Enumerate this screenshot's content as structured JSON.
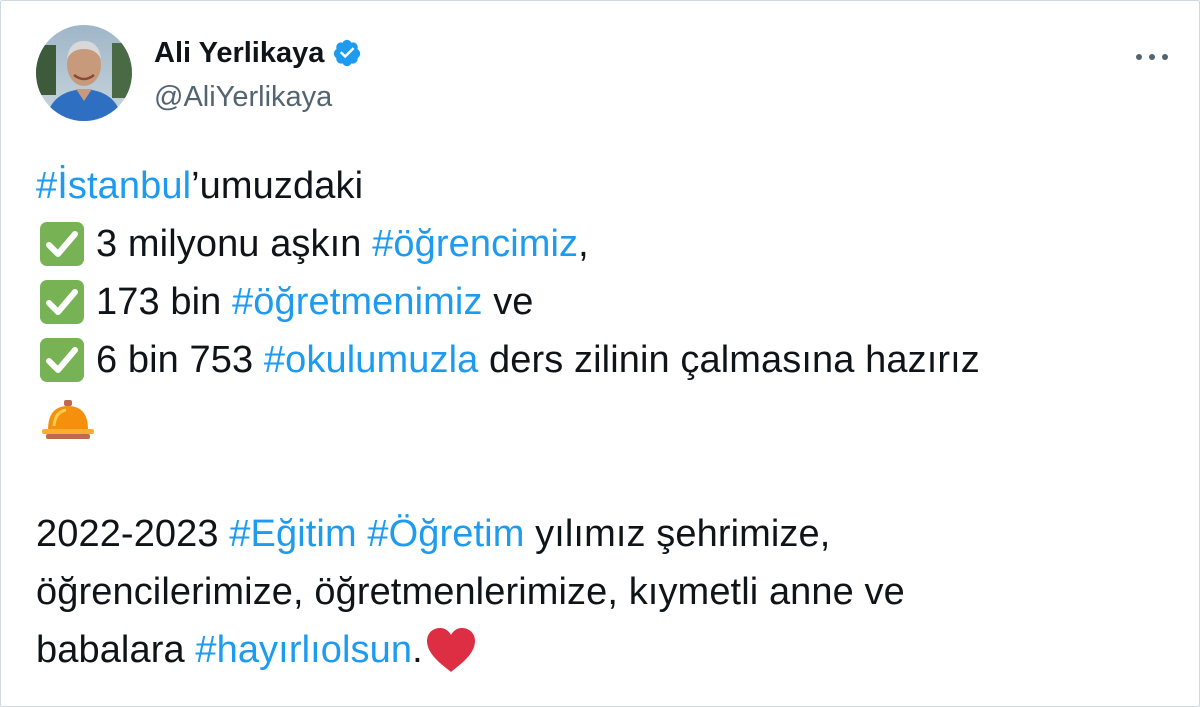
{
  "author": {
    "display_name": "Ali Yerlikaya",
    "handle": "@AliYerlikaya",
    "verified_icon": "verified-badge-icon",
    "avatar_icon": "profile-photo"
  },
  "menu": {
    "more_icon": "more-horizontal-icon"
  },
  "tweet": {
    "l1_tag": "#İstanbul",
    "l1_text": "’umuzdaki",
    "l2_text": "3 milyonu aşkın ",
    "l2_tag": "#öğrencimiz",
    "l2_tail": ",",
    "l3_text": "173 bin ",
    "l3_tag": "#öğretmenimiz",
    "l3_tail": " ve",
    "l4_text": "6 bin 753 ",
    "l4_tag": "#okulumuzla",
    "l4_tail": " ders zilinin çalmasına hazırız",
    "p2_l1_text": "2022-2023 ",
    "p2_l1_tag1": "#Eğitim",
    "p2_l1_tag2": "#Öğretim",
    "p2_l1_tail": " yılımız şehrimize,",
    "p2_l2_text": "öğrencilerimize, öğretmenlerimize, kıymetli anne ve",
    "p2_l3_text": "babalara ",
    "p2_l3_tag": "#hayırlıolsun",
    "p2_l3_tail": "."
  },
  "colors": {
    "link": "#1d9bf0",
    "check_emoji": "#77b255",
    "heart_emoji": "#dd2e44",
    "verified": "#1d9bf0",
    "secondary_text": "#536471"
  },
  "emoji": {
    "check": "check-mark-button-emoji",
    "bell": "bellhop-bell-emoji",
    "heart": "red-heart-emoji"
  }
}
